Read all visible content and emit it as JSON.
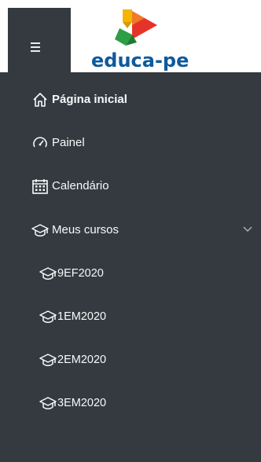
{
  "header": {
    "menu_icon": "hamburger-icon",
    "logo_text": "educa-pe",
    "logo_colors": [
      "#f5b400",
      "#e6332a",
      "#2e9e44",
      "#0e5a9c"
    ]
  },
  "nav": {
    "items": [
      {
        "label": "Página inicial",
        "icon": "home-icon",
        "active": true
      },
      {
        "label": "Painel",
        "icon": "dashboard-icon"
      },
      {
        "label": "Calendário",
        "icon": "calendar-icon"
      },
      {
        "label": "Meus cursos",
        "icon": "graduation-cap-icon",
        "expanded": true,
        "toggle_icon": "chevron-down-icon"
      }
    ],
    "courses": [
      {
        "label": "9EF2020",
        "icon": "graduation-cap-icon"
      },
      {
        "label": "1EM2020",
        "icon": "graduation-cap-icon"
      },
      {
        "label": "2EM2020",
        "icon": "graduation-cap-icon"
      },
      {
        "label": "3EM2020",
        "icon": "graduation-cap-icon"
      }
    ]
  },
  "colors": {
    "drawer_bg": "#343a40",
    "text": "#f8f9fa",
    "logo_blue": "#0e5a9c"
  }
}
